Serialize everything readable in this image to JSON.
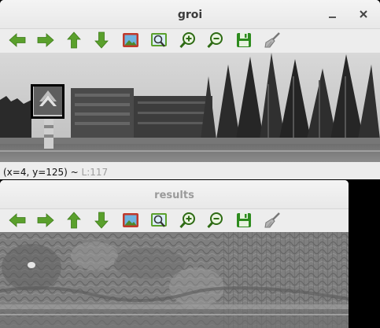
{
  "windows": [
    {
      "title": "groi",
      "status_coords": "(x=4, y=125) ~",
      "status_level": "L:117"
    },
    {
      "title": "results"
    }
  ],
  "toolbar_icons": [
    "arrow-left-icon",
    "arrow-right-icon",
    "arrow-up-icon",
    "arrow-down-icon",
    "image-icon",
    "zoom-fit-icon",
    "zoom-in-icon",
    "zoom-out-icon",
    "save-icon",
    "brush-icon"
  ],
  "colors": {
    "arrow_green": "#5aa02c",
    "titlebar": "#ededed",
    "selection_box": "#000000"
  }
}
